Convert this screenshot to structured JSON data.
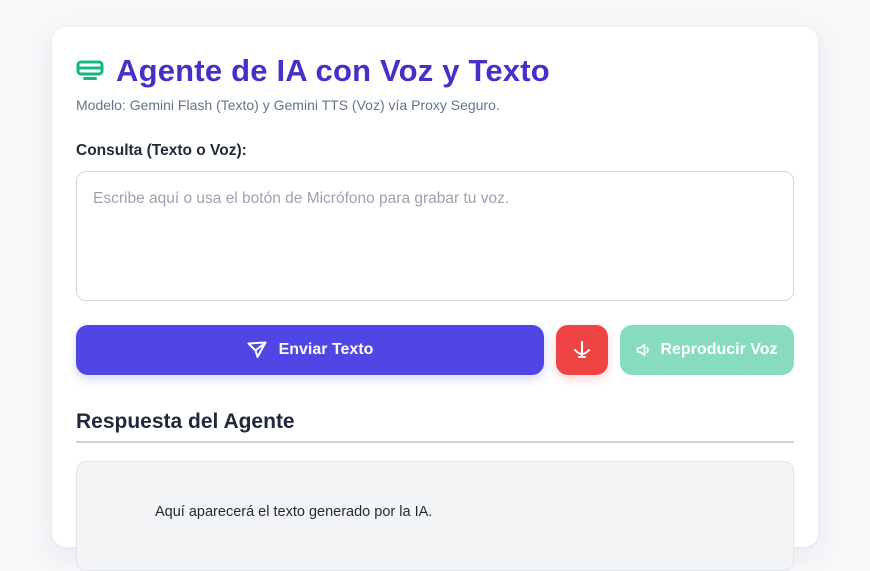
{
  "header": {
    "icon": "monitor-icon",
    "title": "Agente de IA con Voz y Texto",
    "subtitle": "Modelo: Gemini Flash (Texto) y Gemini TTS (Voz) vía Proxy Seguro."
  },
  "query": {
    "label": "Consulta (Texto o Voz):",
    "value": "",
    "placeholder": "Escribe aquí o usa el botón de Micrófono para grabar tu voz."
  },
  "actions": {
    "send_label": "Enviar Texto",
    "send_icon": "send-icon",
    "mic_icon": "microphone-icon",
    "play_label": "Reproducir Voz",
    "play_icon": "speaker-icon"
  },
  "response": {
    "title": "Respuesta del Agente",
    "text": "Aquí aparecerá el texto generado por la IA."
  },
  "colors": {
    "title": "#4a2fc7",
    "header_icon": "#10b981",
    "send_button": "#4f46e5",
    "mic_button": "#ef4444",
    "play_button_disabled": "#86dcbc"
  }
}
